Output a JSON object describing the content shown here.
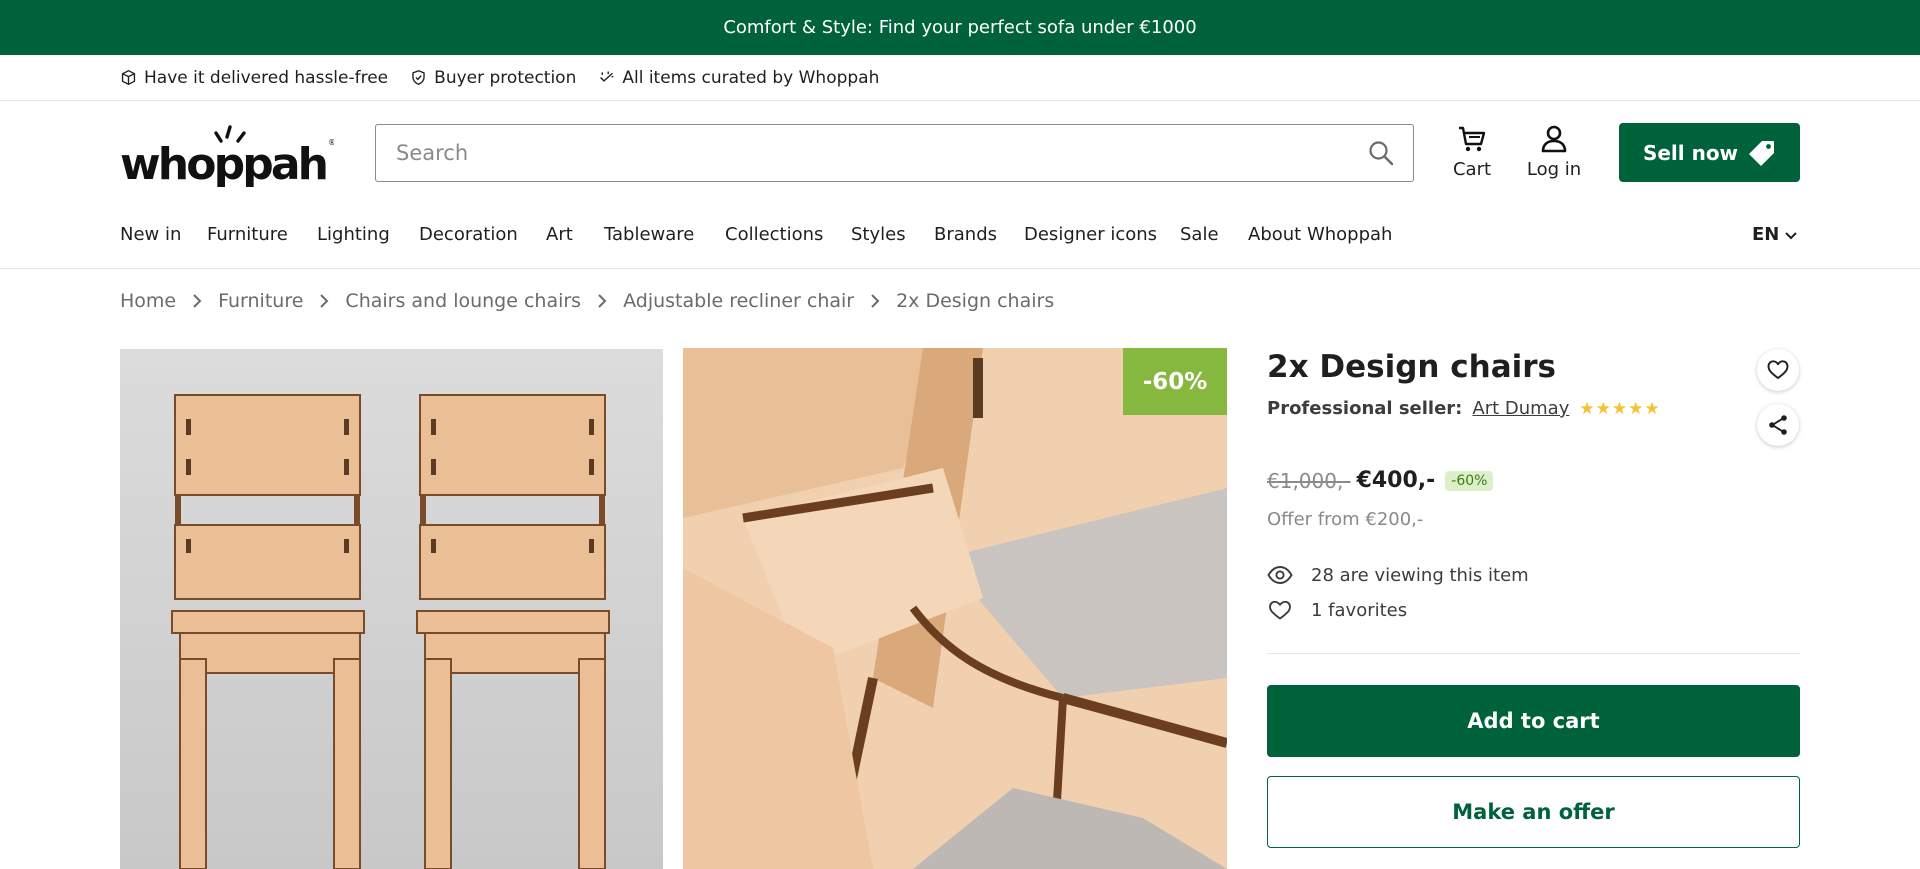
{
  "promo": {
    "text": "Comfort & Style: Find your perfect sofa under €1000"
  },
  "usps": [
    {
      "icon": "box-icon",
      "label": "Have it delivered hassle-free"
    },
    {
      "icon": "shield-check-icon",
      "label": "Buyer protection"
    },
    {
      "icon": "sparkle-check-icon",
      "label": "All items curated by Whoppah"
    }
  ],
  "header": {
    "logo_text": "whoppah",
    "search_placeholder": "Search",
    "cart_label": "Cart",
    "login_label": "Log in",
    "sell_label": "Sell now"
  },
  "nav": {
    "items": [
      "New in",
      "Furniture",
      "Lighting",
      "Decoration",
      "Art",
      "Tableware",
      "Collections",
      "Styles",
      "Brands",
      "Designer icons",
      "Sale",
      "About Whoppah"
    ],
    "language": "EN"
  },
  "breadcrumb": [
    "Home",
    "Furniture",
    "Chairs and lounge chairs",
    "Adjustable recliner chair",
    "2x Design chairs"
  ],
  "product": {
    "title": "2x Design chairs",
    "seller_label": "Professional seller:",
    "seller_name": "Art Dumay",
    "rating": 5,
    "rating_stars": "★★★★★",
    "image_badge": "-60%",
    "old_price": "€1,000,-",
    "price": "€400,-",
    "discount": "-60%",
    "offer_from": "Offer from €200,-",
    "viewing": "28 are viewing this item",
    "favorites": "1 favorites",
    "add_to_cart_label": "Add to cart",
    "make_offer_label": "Make an offer"
  },
  "colors": {
    "brand_green": "#00623a",
    "badge_green": "#86b840",
    "star_yellow": "#f2c230"
  }
}
